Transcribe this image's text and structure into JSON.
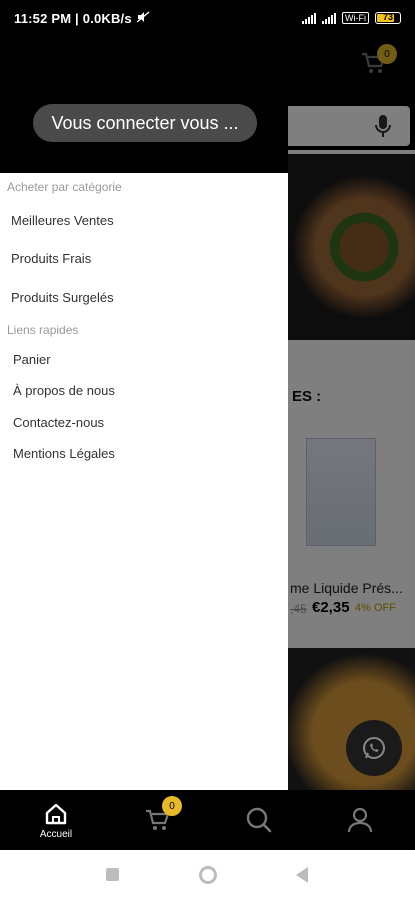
{
  "statusbar": {
    "time": "11:52 PM | 0.0KB/s",
    "wifi": "Wi-Fi",
    "battery": "73"
  },
  "background_page": {
    "cart_badge": "0",
    "section_title": "ES :",
    "product_name": "me Liquide Prés...",
    "old_price": ",45",
    "price": "€2,35",
    "discount": "4% OFF"
  },
  "drawer": {
    "login_button": "Vous connecter vous ...",
    "section_categories": "Acheter par catégorie",
    "categories": [
      "Meilleures Ventes",
      "Produits Frais",
      "Produits Surgelés"
    ],
    "section_links": "Liens rapides",
    "links": [
      "Panier",
      "À propos de nous",
      "Contactez-nous",
      "Mentions Légales"
    ]
  },
  "bottomnav": {
    "home_label": "Accueil",
    "cart_badge": "0"
  }
}
